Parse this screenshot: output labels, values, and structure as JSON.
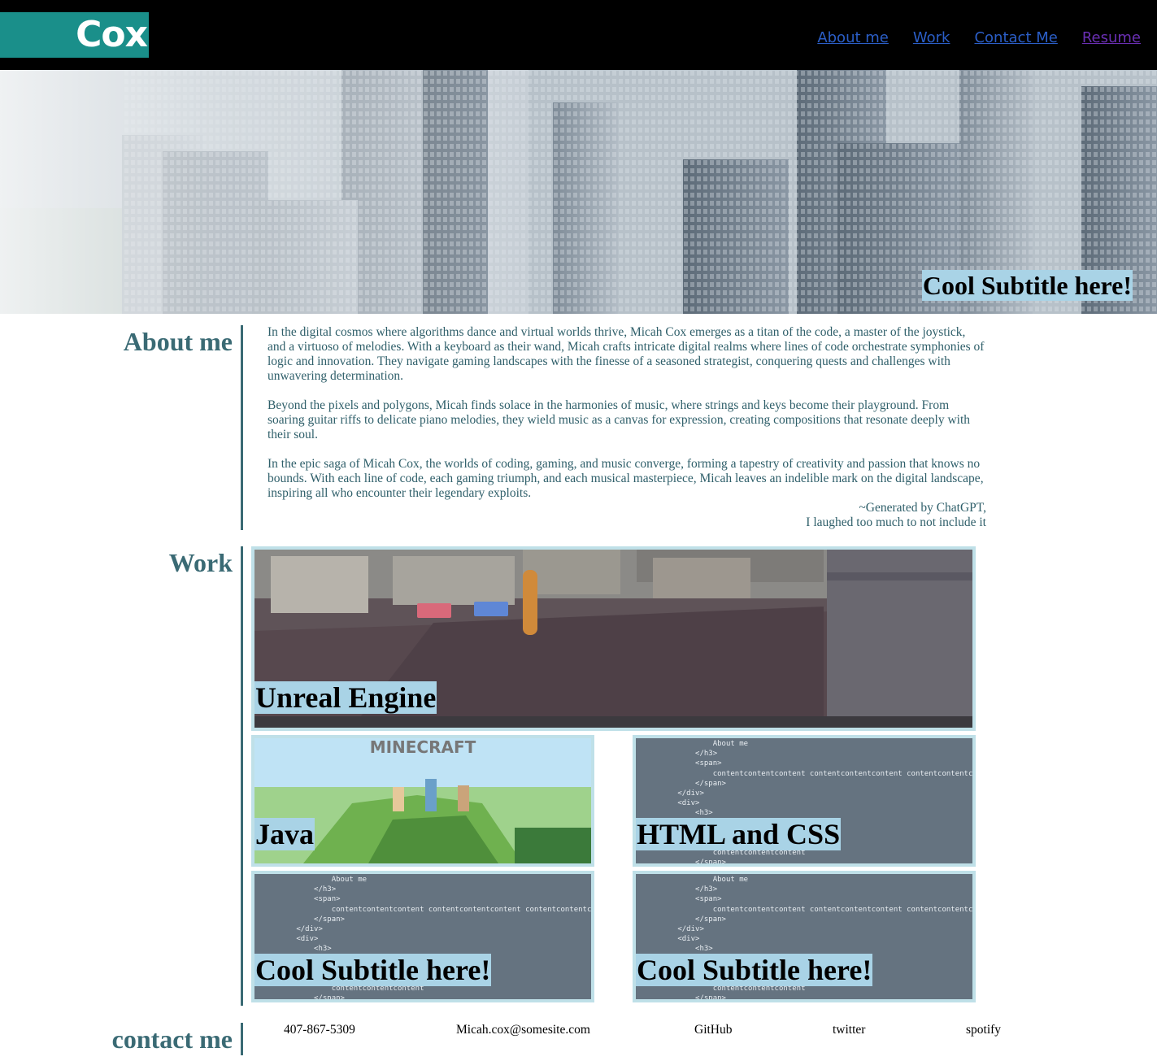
{
  "header": {
    "logo_text": "Cox",
    "nav": [
      {
        "label": "About me"
      },
      {
        "label": "Work"
      },
      {
        "label": "Contact Me"
      },
      {
        "label": "Resume"
      }
    ]
  },
  "hero": {
    "subtitle": "Cool Subtitle here!"
  },
  "about": {
    "heading": "About me",
    "paragraphs": [
      "In the digital cosmos where algorithms dance and virtual worlds thrive, Micah Cox emerges as a titan of the code, a master of the joystick, and a virtuoso of melodies. With a keyboard as their wand, Micah crafts intricate digital realms where lines of code orchestrate symphonies of logic and innovation. They navigate gaming landscapes with the finesse of a seasoned strategist, conquering quests and challenges with unwavering determination.",
      "Beyond the pixels and polygons, Micah finds solace in the harmonies of music, where strings and keys become their playground. From soaring guitar riffs to delicate piano melodies, they wield music as a canvas for expression, creating compositions that resonate deeply with their soul.",
      "In the epic saga of Micah Cox, the worlds of coding, gaming, and music converge, forming a tapestry of creativity and passion that knows no bounds. With each line of code, each gaming triumph, and each musical masterpiece, Micah leaves an indelible mark on the digital landscape, inspiring all who encounter their legendary exploits."
    ],
    "signature_line1": "~Generated by ChatGPT,",
    "signature_line2": "I laughed too much to not include it"
  },
  "work": {
    "heading": "Work",
    "cards": [
      {
        "label": "Unreal Engine"
      },
      {
        "label": "Java"
      },
      {
        "label": "HTML and CSS"
      },
      {
        "label": "Cool Subtitle here!"
      },
      {
        "label": "Cool Subtitle here!"
      }
    ],
    "code_snippet": "                About me\n            </h3>\n            <span>\n                contentcontentcontent contentcontentcontent contentcontentcontent\n            </span>\n        </div>\n        <div>\n            <h3>\n                About me\n            </h3>\n            <span>\n                contentcontentcontent\n            </span>",
    "minecraft_logo": "MINECRAFT"
  },
  "contact": {
    "heading": "contact me",
    "items": [
      {
        "label": "407-867-5309"
      },
      {
        "label": "Micah.cox@somesite.com"
      },
      {
        "label": "GitHub"
      },
      {
        "label": "twitter"
      },
      {
        "label": "spotify"
      }
    ]
  },
  "colors": {
    "accent": "#3a6a74",
    "logo_bg": "#1a8f8a",
    "label_bg": "#a9d3e6",
    "card_border": "#bfe0e8"
  }
}
